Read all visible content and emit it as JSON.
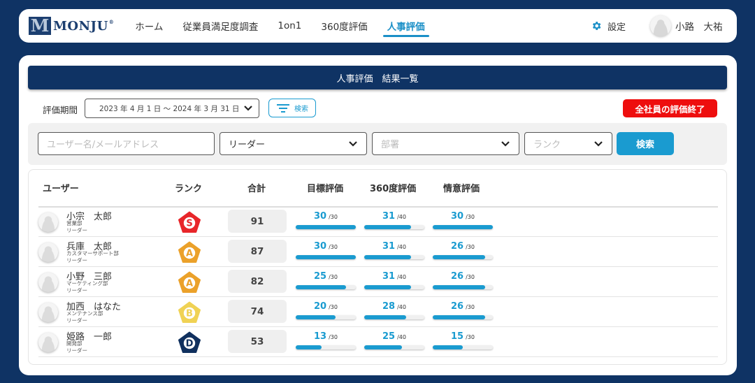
{
  "header": {
    "logo_text": "MONJU",
    "logo_mark": "M",
    "logo_reg": "®",
    "nav": [
      {
        "label": "ホーム",
        "active": false
      },
      {
        "label": "従業員満足度調査",
        "active": false
      },
      {
        "label": "1on1",
        "active": false
      },
      {
        "label": "360度評価",
        "active": false
      },
      {
        "label": "人事評価",
        "active": true
      }
    ],
    "settings_label": "設定",
    "user_name": "小路　大祐"
  },
  "page": {
    "title": "人事評価　結果一覧",
    "period_label": "評価期間",
    "period_value": "2023 年 4 月 1 日 〜 2024 年 3 月 31 日",
    "filter_button": "検索",
    "finish_button": "全社員の評価終了"
  },
  "search": {
    "user_placeholder": "ユーザー名/メールアドレス",
    "role_value": "リーダー",
    "dept_placeholder": "部署",
    "rank_placeholder": "ランク",
    "search_button": "検索"
  },
  "table": {
    "headers": {
      "user": "ユーザー",
      "rank": "ランク",
      "total": "合計",
      "goal": "目標評価",
      "d360": "360度評価",
      "attitude": "情意評価"
    },
    "rows": [
      {
        "name": "小宗　太郎",
        "dept": "営業部",
        "role": "リーダー",
        "rank": "S",
        "total": "91",
        "goal": "30",
        "goal_max": "/30",
        "d360": "31",
        "d360_max": "/40",
        "attitude": "30",
        "attitude_max": "/30"
      },
      {
        "name": "兵庫　太郎",
        "dept": "カスタマーサポート部",
        "role": "リーダー",
        "rank": "A",
        "total": "87",
        "goal": "30",
        "goal_max": "/30",
        "d360": "31",
        "d360_max": "/40",
        "attitude": "26",
        "attitude_max": "/30"
      },
      {
        "name": "小野　三郎",
        "dept": "マーケティング部",
        "role": "リーダー",
        "rank": "A",
        "total": "82",
        "goal": "25",
        "goal_max": "/30",
        "d360": "31",
        "d360_max": "/40",
        "attitude": "26",
        "attitude_max": "/30"
      },
      {
        "name": "加西　はなた",
        "dept": "メンテナンス部",
        "role": "リーダー",
        "rank": "B",
        "total": "74",
        "goal": "20",
        "goal_max": "/30",
        "d360": "28",
        "d360_max": "/40",
        "attitude": "26",
        "attitude_max": "/30"
      },
      {
        "name": "姫路　一郎",
        "dept": "開発部",
        "role": "リーダー",
        "rank": "D",
        "total": "53",
        "goal": "13",
        "goal_max": "/30",
        "d360": "25",
        "d360_max": "/40",
        "attitude": "15",
        "attitude_max": "/30"
      }
    ]
  },
  "colors": {
    "navy": "#0f3364",
    "accent": "#1a9bd0",
    "danger": "#ee0e0e",
    "rank_S": "#e8262a",
    "rank_A": "#eba12a",
    "rank_B": "#f0d254",
    "rank_D": "#10305e"
  },
  "icons": {
    "settings": "gear-icon",
    "filter": "filter-icon",
    "dropdown": "chevron-down-icon",
    "avatar": "user-avatar-icon"
  }
}
